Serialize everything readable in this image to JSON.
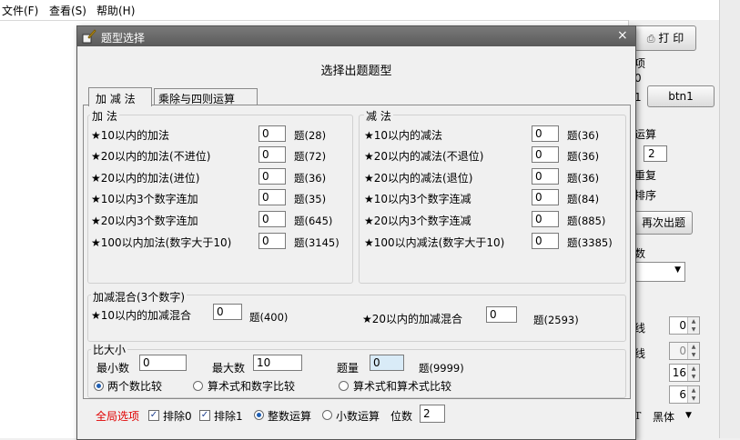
{
  "menubar": {
    "file": "文件(F)",
    "view": "查看(S)",
    "help": "帮助(H)"
  },
  "bg": {
    "print_label": "打 印",
    "frag1": "项",
    "frag2": "0",
    "frag3": "1",
    "btn1_label": "btn1",
    "frag_op": "运算",
    "op_value": "2",
    "frag_repeat": "重复",
    "frag_sort": "排序",
    "again_label": "再次出题",
    "frag_count": "数",
    "frag_line1": "线",
    "frag_line2": "线",
    "spin1": "0",
    "spin2": "0",
    "spin3": "16",
    "spin4": "6",
    "font_name": "黑体"
  },
  "dialog": {
    "title": "题型选择",
    "close": "×",
    "heading": "选择出题题型",
    "tabs": [
      {
        "label": "加 减 法"
      },
      {
        "label": "乘除与四则运算"
      }
    ],
    "add": {
      "title": "加  法",
      "rows": [
        {
          "label": "★10以内的加法",
          "value": "0",
          "count": "题(28)"
        },
        {
          "label": "★20以内的加法(不进位)",
          "value": "0",
          "count": "题(72)"
        },
        {
          "label": "★20以内的加法(进位)",
          "value": "0",
          "count": "题(36)"
        },
        {
          "label": "★10以内3个数字连加",
          "value": "0",
          "count": "题(35)"
        },
        {
          "label": "★20以内3个数字连加",
          "value": "0",
          "count": "题(645)"
        },
        {
          "label": "★100以内加法(数字大于10)",
          "value": "0",
          "count": "题(3145)"
        }
      ]
    },
    "sub": {
      "title": "减  法",
      "rows": [
        {
          "label": "★10以内的减法",
          "value": "0",
          "count": "题(36)"
        },
        {
          "label": "★20以内的减法(不退位)",
          "value": "0",
          "count": "题(36)"
        },
        {
          "label": "★20以内的减法(退位)",
          "value": "0",
          "count": "题(36)"
        },
        {
          "label": "★10以内3个数字连减",
          "value": "0",
          "count": "题(84)"
        },
        {
          "label": "★20以内3个数字连减",
          "value": "0",
          "count": "题(885)"
        },
        {
          "label": "★100以内减法(数字大于10)",
          "value": "0",
          "count": "题(3385)"
        }
      ]
    },
    "mixed": {
      "title": "加减混合(3个数字)",
      "rows": [
        {
          "label": "★10以内的加减混合",
          "value": "0",
          "count": "题(400)"
        },
        {
          "label": "★20以内的加减混合",
          "value": "0",
          "count": "题(2593)"
        }
      ]
    },
    "compare": {
      "title": "比大小",
      "min_label": "最小数",
      "min_value": "0",
      "max_label": "最大数",
      "max_value": "10",
      "qty_label": "题量",
      "qty_value": "0",
      "qty_count": "题(9999)",
      "options": [
        {
          "label": "两个数比较",
          "selected": true
        },
        {
          "label": "算术式和数字比较",
          "selected": false
        },
        {
          "label": "算术式和算术式比较",
          "selected": false
        }
      ]
    },
    "global": {
      "title": "全局选项",
      "exclude0": "排除0",
      "exclude1": "排除1",
      "integer": "整数运算",
      "decimal": "小数运算",
      "digits_label": "位数",
      "digits_value": "2"
    }
  },
  "colors": {
    "global_title": "#e00000",
    "titlebar": "#6a6a6a",
    "highlight_input": "#d9ebf7"
  }
}
